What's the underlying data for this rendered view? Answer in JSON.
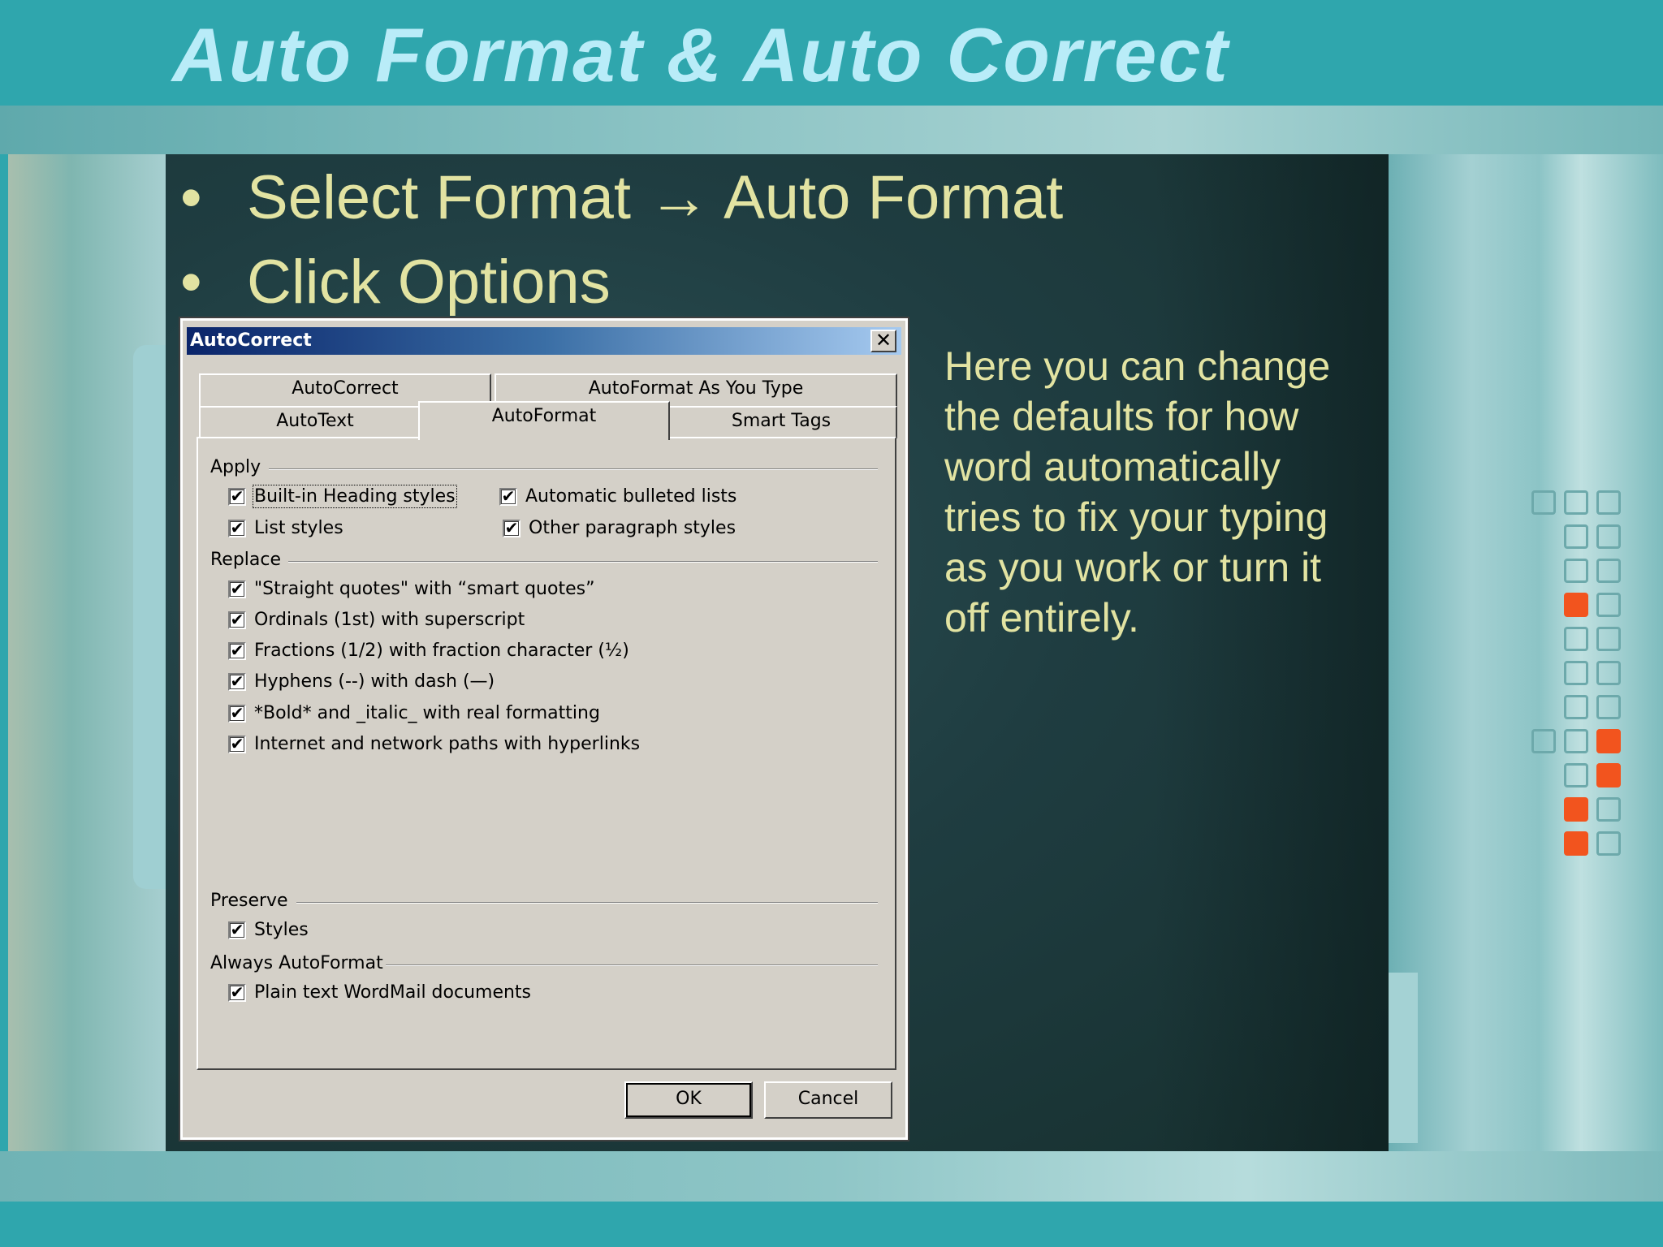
{
  "slide": {
    "title": "Auto Format & Auto Correct",
    "bullets": [
      {
        "bullet": "•",
        "text": "Select Format → Auto Format"
      },
      {
        "bullet": "•",
        "text": "Click Options"
      }
    ],
    "side_text": "Here you can change the defaults for how word automatically tries to fix your typing as you work or turn it off entirely."
  },
  "dialog": {
    "title": "AutoCorrect",
    "close_glyph": "✕",
    "tabs_row1": [
      "AutoCorrect",
      "AutoFormat As You Type"
    ],
    "tabs_row2": [
      "AutoText",
      "AutoFormat",
      "Smart Tags"
    ],
    "active_tab": "AutoFormat",
    "check_glyph": "✔",
    "groups": {
      "apply": {
        "label": "Apply",
        "items": [
          {
            "label": "Built-in Heading styles",
            "checked": true
          },
          {
            "label": "Automatic bulleted lists",
            "checked": true
          },
          {
            "label": "List styles",
            "checked": true
          },
          {
            "label": "Other paragraph styles",
            "checked": true
          }
        ]
      },
      "replace": {
        "label": "Replace",
        "items": [
          {
            "label": "\"Straight quotes\" with “smart quotes”",
            "checked": true
          },
          {
            "label": "Ordinals (1st) with superscript",
            "checked": true
          },
          {
            "label": "Fractions (1/2) with fraction character (½)",
            "checked": true
          },
          {
            "label": "Hyphens (--) with dash (—)",
            "checked": true
          },
          {
            "label": "*Bold* and _italic_ with real formatting",
            "checked": true
          },
          {
            "label": "Internet and network paths with hyperlinks",
            "checked": true
          }
        ]
      },
      "preserve": {
        "label": "Preserve",
        "items": [
          {
            "label": "Styles",
            "checked": true
          }
        ]
      },
      "always": {
        "label": "Always AutoFormat",
        "items": [
          {
            "label": "Plain text WordMail documents",
            "checked": true
          }
        ]
      }
    },
    "buttons": {
      "ok": "OK",
      "cancel": "Cancel"
    }
  },
  "colors": {
    "background": "#2fa6ad",
    "title": "#b9ecf8",
    "body_text": "#e2e3a2",
    "accent_square": "#f2541e",
    "dialog_face": "#d4d0c8",
    "titlebar_start": "#0a246a"
  }
}
